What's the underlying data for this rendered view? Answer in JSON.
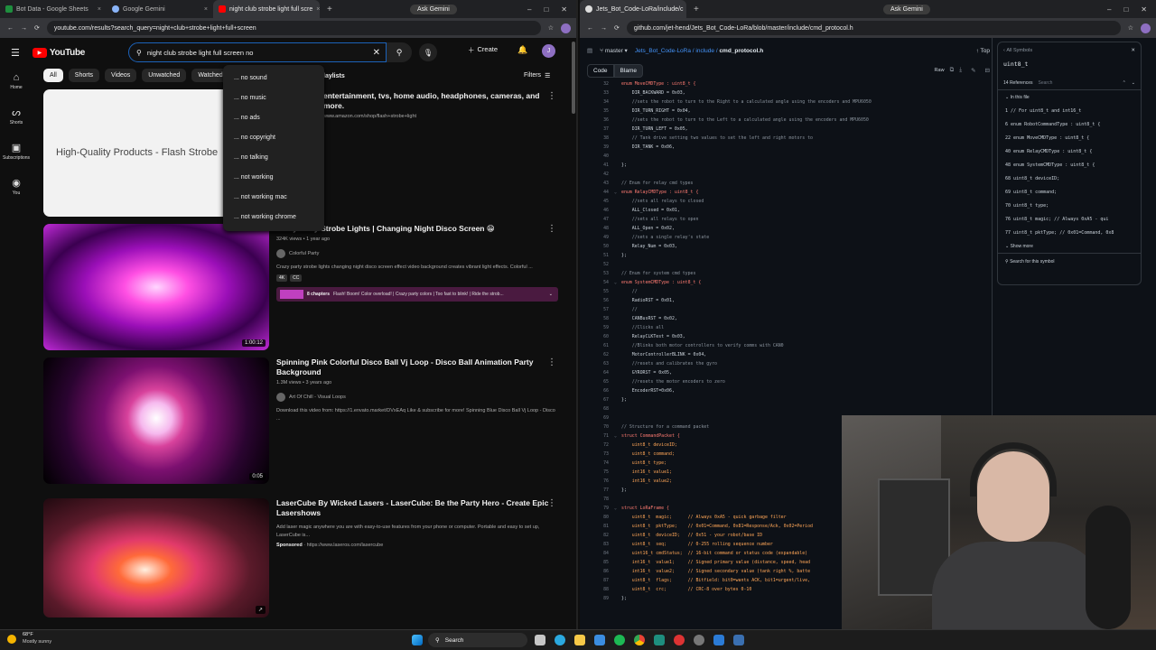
{
  "left_browser": {
    "tabs": [
      "Bot Data - Google Sheets",
      "Google Gemini",
      "night club strobe light full scre"
    ],
    "ask_gemini": "Ask Gemini",
    "url": "youtube.com/results?search_query=night+club+strobe+light+full+screen"
  },
  "youtube": {
    "logo": "YouTube",
    "search_value": "night club strobe light full screen no",
    "create_label": "Create",
    "avatar": "J",
    "filters_label": "Filters",
    "chips": [
      "All",
      "Shorts",
      "Videos",
      "Unwatched",
      "Watched"
    ],
    "chip_partial": "laylists",
    "nav": [
      "Home",
      "Shorts",
      "Subscriptions",
      "You"
    ],
    "suggestions": [
      "... no sound",
      "... no music",
      "... no ads",
      "... no copyright",
      "... no talking",
      "... not working",
      "... not working mac",
      "... not working chrome"
    ],
    "ad": {
      "thumb_text": "High-Quality Products - Flash Strobe",
      "desc": "entertainment, tvs, home audio, headphones, cameras, and more.",
      "link": "www.amazon.com/shop/flash+strobe+light"
    },
    "videos": [
      {
        "title": "Crazy Party Strobe Lights | Changing Night Disco Screen 😁",
        "meta": "324K views • 1 year ago",
        "channel": "Colorful Party",
        "desc": "Crazy party strobe lights changing night disco screen effect video background creates vibrant light effects. Colorful ...",
        "badges": [
          "4K",
          "CC"
        ],
        "chapters": "8 chapters",
        "chapters_text": "Flash! Boom! Color overload! | Crazy party colors | Too fast to blink! | Ride the strob...",
        "duration": "1:00:12"
      },
      {
        "title": "Spinning Pink Colorful Disco Ball Vj Loop - Disco Ball Animation Party Background",
        "meta": "1.3M views • 3 years ago",
        "channel": "Art Of Chill - Visual Loops",
        "desc": "Download this video from: https://1.envato.market/DVxEAq Like & subscribe for more! Spinning Blue Disco Ball Vj Loop - Disco ...",
        "duration": "0:05"
      },
      {
        "title": "LaserCube By Wicked Lasers - LaserCube: Be the Party Hero - Create Epic Lasershows",
        "desc": "Add laser magic anywhere you are with easy-to-use features from your phone or computer. Portable and easy to set up, LaserCube is...",
        "sponsored": "Sponsored",
        "sponsor_link": "· https://www.laseros.com/lasercube"
      }
    ]
  },
  "right_browser": {
    "tab": "Jets_Bot_Code-LoRa/include/c",
    "ask_gemini": "Ask Gemini",
    "url": "github.com/jet-hend/Jets_Bot_Code-LoRa/blob/master/include/cmd_protocol.h"
  },
  "github": {
    "branch": "master",
    "path": [
      "Jets_Bot_Code-LoRa",
      "include",
      "cmd_protocol.h"
    ],
    "top": "Top",
    "tabs": [
      "Code",
      "Blame"
    ],
    "raw": "Raw",
    "code_lines": [
      [
        "32",
        "enum MoveCMDType : uint8_t {"
      ],
      [
        "33",
        "    DIR_BACKWARD = 0x03,"
      ],
      [
        "34",
        "    //sets the robot to turn to the Right to a calculated angle using the encoders and MPU6050"
      ],
      [
        "35",
        "    DIR_TURN_RIGHT = 0x04,"
      ],
      [
        "36",
        "    //sets the robot to turn to the Left to a calculated angle using the encoders and MPU6050"
      ],
      [
        "37",
        "    DIR_TURN_LEFT = 0x05,"
      ],
      [
        "38",
        "    // Tank drive setting two values to set the left and right motors to"
      ],
      [
        "39",
        "    DIR_TANK = 0x06,"
      ],
      [
        "40",
        ""
      ],
      [
        "41",
        "};"
      ],
      [
        "42",
        ""
      ],
      [
        "43",
        "// Enum for relay cmd types"
      ],
      [
        "44",
        "enum RelayCMDType : uint8_t {"
      ],
      [
        "45",
        "    //sets all relays to closed"
      ],
      [
        "46",
        "    ALL_Closed = 0x01,"
      ],
      [
        "47",
        "    //sets all relays to open"
      ],
      [
        "48",
        "    ALL_Open = 0x02,"
      ],
      [
        "49",
        "    //sets a single relay's state"
      ],
      [
        "50",
        "    Relay_Num = 0x03,"
      ],
      [
        "51",
        "};"
      ],
      [
        "52",
        ""
      ],
      [
        "53",
        "// Enum for system cmd types"
      ],
      [
        "54",
        "enum SystemCMDType : uint8_t {"
      ],
      [
        "55",
        "    //"
      ],
      [
        "56",
        "    RadioRST = 0x01,"
      ],
      [
        "57",
        "    //"
      ],
      [
        "58",
        "    CANBusRST = 0x02,"
      ],
      [
        "59",
        "    //Clicks all"
      ],
      [
        "60",
        "    RelayCLKTest = 0x03,"
      ],
      [
        "61",
        "    //Blinks both motor controllers to verify comms with CAN0"
      ],
      [
        "62",
        "    MotorControllerBLINK = 0x04,"
      ],
      [
        "63",
        "    //resets and calibrates the gyro"
      ],
      [
        "64",
        "    GYRORST = 0x05,"
      ],
      [
        "65",
        "    //resets the motor encoders to zero"
      ],
      [
        "66",
        "    EncoderRST=0x06,"
      ],
      [
        "67",
        "};"
      ],
      [
        "68",
        ""
      ],
      [
        "69",
        ""
      ],
      [
        "70",
        "// Structure for a command packet"
      ],
      [
        "71",
        "struct CommandPacket {"
      ],
      [
        "72",
        "    uint8_t deviceID;"
      ],
      [
        "73",
        "    uint8_t command;"
      ],
      [
        "74",
        "    uint8_t type;"
      ],
      [
        "75",
        "    int16_t value1;"
      ],
      [
        "76",
        "    int16_t value2;"
      ],
      [
        "77",
        "};"
      ],
      [
        "78",
        ""
      ],
      [
        "79",
        "struct LoRaFrame {"
      ],
      [
        "80",
        "    uint8_t  magic;      // Always 0xA5 - quick garbage filter"
      ],
      [
        "81",
        "    uint8_t  pktType;    // 0x01=Command, 0x81=Response/Ack, 0x02=Period"
      ],
      [
        "82",
        "    uint8_t  deviceID;   // 0x51 - your robot/base ID"
      ],
      [
        "83",
        "    uint8_t  seq;        // 0-255 rolling sequence number"
      ],
      [
        "84",
        "    uint16_t cmdStatus;  // 16-bit command or status code (expandable)"
      ],
      [
        "85",
        "    int16_t  value1;     // Signed primary value (distance, speed, head"
      ],
      [
        "86",
        "    int16_t  value2;     // Signed secondary value (tank right %, batte"
      ],
      [
        "87",
        "    uint8_t  flags;      // Bitfield: bit0=wants ACK, bit1=urgent/live,"
      ],
      [
        "88",
        "    uint8_t  crc;        // CRC-8 over bytes 0-10"
      ],
      [
        "89",
        "};"
      ]
    ],
    "symbols": {
      "header": "All Symbols",
      "symbol": "uint8_t",
      "refs": "14 References",
      "search_ph": "Search",
      "in_file": "In this file",
      "rows": [
        "1  // For uint8_t and int16_t",
        "6  enum RobotCommandType : uint8_t {",
        "22 enum MoveCMDType : uint8_t {",
        "40 enum RelayCMDType : uint8_t {",
        "48 enum SystemCMDType : uint8_t {",
        "68    uint8_t deviceID;",
        "69    uint8_t command;",
        "70    uint8_t type;",
        "76    uint8_t  magic;     // Always 0xA5 - qui",
        "77    uint8_t  pktType;   // 0x01=Command, 0x8"
      ],
      "show_more": "Show more",
      "search_symbol": "Search for this symbol"
    }
  },
  "taskbar": {
    "temp": "68°F",
    "weather": "Mostly sunny",
    "search": "Search"
  }
}
